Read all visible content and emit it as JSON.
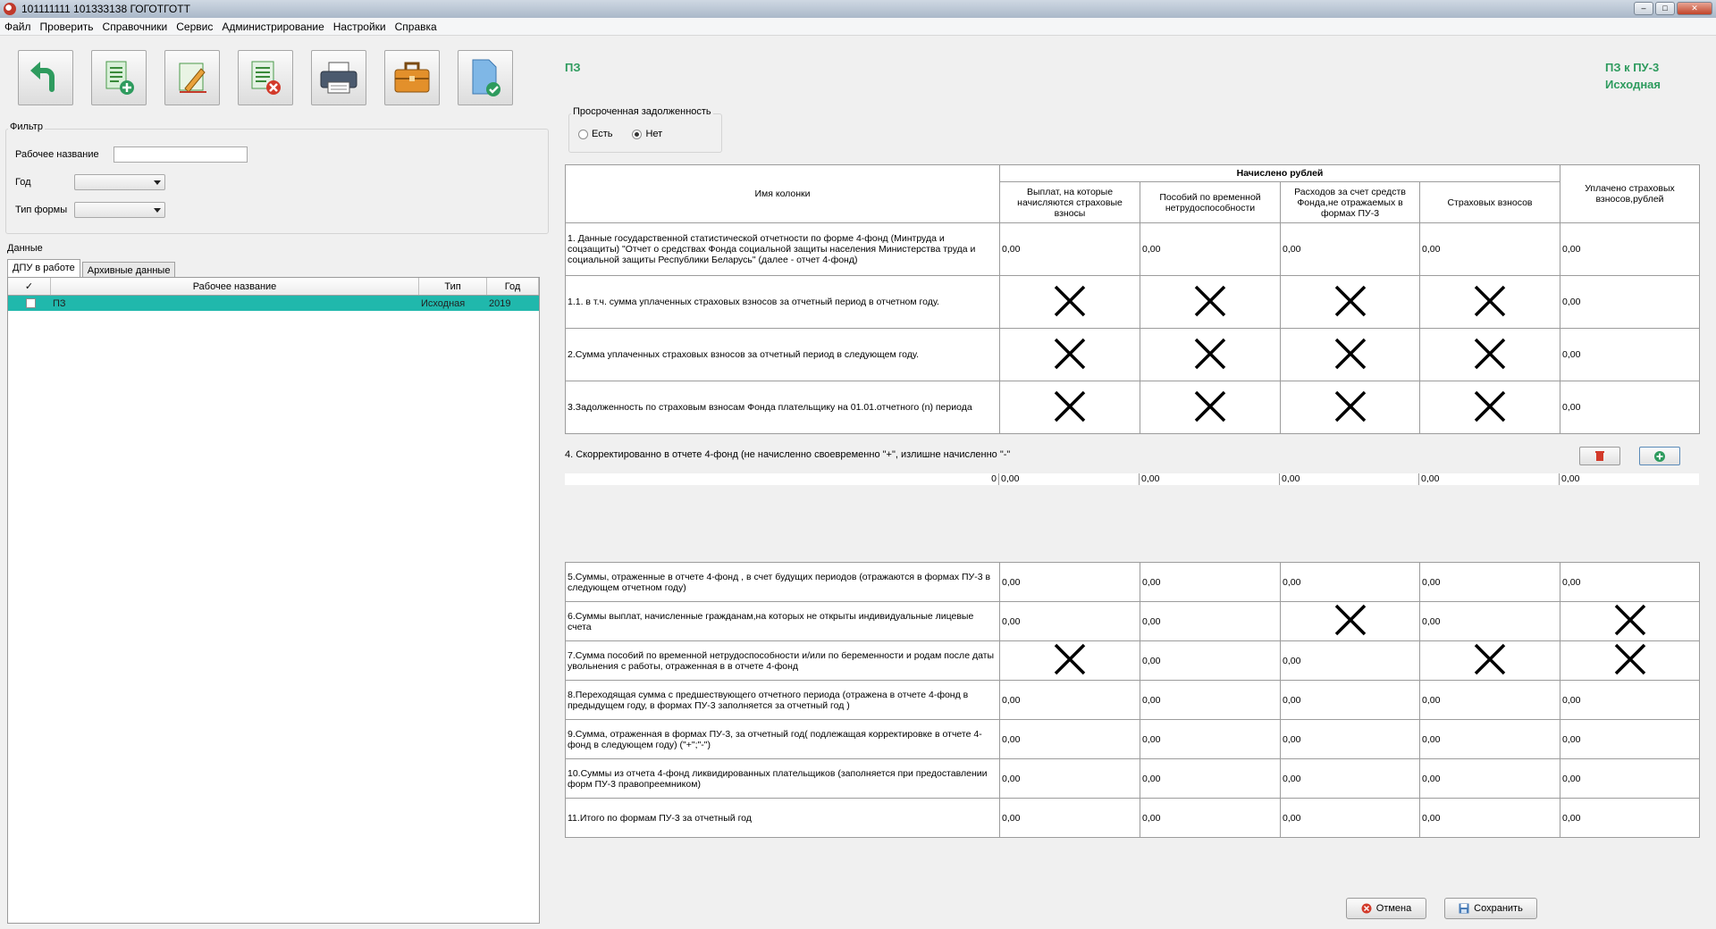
{
  "window": {
    "title": "101111111 101333138 ГОГОТГОТТ"
  },
  "menu": [
    "Файл",
    "Проверить",
    "Справочники",
    "Сервис",
    "Администрирование",
    "Настройки",
    "Справка"
  ],
  "toolbar": {
    "icons": [
      "back-arrow-icon",
      "add-document-icon",
      "edit-document-icon",
      "delete-document-icon",
      "printer-icon",
      "briefcase-icon",
      "check-document-icon"
    ]
  },
  "filter": {
    "title": "Фильтр",
    "name_label": "Рабочее название",
    "name_value": "",
    "year_label": "Год",
    "year_value": "",
    "form_label": "Тип формы",
    "form_value": ""
  },
  "data_section": {
    "title": "Данные",
    "tabs": [
      "ДПУ в работе",
      "Архивные данные"
    ],
    "columns": [
      "✓",
      "Рабочее название",
      "Тип",
      "Год"
    ],
    "rows": [
      {
        "checked": false,
        "name": "ПЗ",
        "type": "Исходная",
        "year": "2019"
      }
    ]
  },
  "form": {
    "short_title": "ПЗ",
    "corner_line1": "ПЗ к ПУ-3",
    "corner_line2": "Исходная",
    "overdue": {
      "title": "Просроченная задолженность",
      "options": [
        "Есть",
        "Нет"
      ],
      "selected": "Нет"
    },
    "table": {
      "col_name_header": "Имя колонки",
      "accrued_header": "Начислено рублей",
      "col_headers": [
        "Выплат, на которые начисляются страховые взносы",
        "Пособий по временной нетрудоспособности",
        "Расходов за счет средств Фонда,не отражаемых в формах ПУ-3",
        "Страховых взносов"
      ],
      "paid_header": "Уплачено страховых взносов,рублей",
      "rows": [
        {
          "label": "1. Данные государственной статистической отчетности по форме 4-фонд (Минтруда и соцзащиты) \"Отчет о средствах Фонда социальной защиты населения Министерства труда и социальной защиты Республики Беларусь\" (далее - отчет 4-фонд)",
          "cells": [
            "0,00",
            "0,00",
            "0,00",
            "0,00",
            "0,00"
          ]
        },
        {
          "label": "1.1. в т.ч. сумма уплаченных страховых взносов за отчетный период в отчетном году.",
          "cells": [
            "X",
            "X",
            "X",
            "X",
            "0,00"
          ]
        },
        {
          "label": "2.Сумма уплаченных страховых взносов за отчетный период в следующем году.",
          "cells": [
            "X",
            "X",
            "X",
            "X",
            "0,00"
          ]
        },
        {
          "label": "3.Задолженность по страховым взносам Фонда плательщику на 01.01.отчетного (n) периода",
          "cells": [
            "X",
            "X",
            "X",
            "X",
            "0,00"
          ]
        }
      ]
    },
    "row4": {
      "label": "4. Скорректированно в отчете 4-фонд (не начисленно своевременно \"+\", излишне начисленно \"-\"",
      "first_value": "0",
      "cells": [
        "0,00",
        "0,00",
        "0,00",
        "0,00",
        "0,00"
      ]
    },
    "lower_rows": [
      {
        "label": "5.Суммы, отраженные в отчете 4-фонд , в счет будущих периодов (отражаются в формах ПУ-3 в следующем отчетном году)",
        "cells": [
          "0,00",
          "0,00",
          "0,00",
          "0,00",
          "0,00"
        ]
      },
      {
        "label": "6.Суммы выплат, начисленные гражданам,на которых не открыты индивидуальные лицевые счета",
        "cells": [
          "0,00",
          "0,00",
          "X",
          "0,00",
          "X"
        ]
      },
      {
        "label": "7.Сумма пособий по временной нетрудоспособности и/или по беременности и родам после даты увольнения с работы, отраженная в в отчете 4-фонд",
        "cells": [
          "X",
          "0,00",
          "0,00",
          "X",
          "X"
        ]
      },
      {
        "label": "8.Переходящая сумма с предшествующего отчетного периода (отражена в отчете 4-фонд в предыдущем году, в формах ПУ-3 заполняется за отчетный год )",
        "cells": [
          "0,00",
          "0,00",
          "0,00",
          "0,00",
          "0,00"
        ]
      },
      {
        "label": "9.Сумма, отраженная в формах ПУ-3, за отчетный год( подлежащая корректировке в отчете 4-фонд в следующем году) (\"+\";\"-\")",
        "cells": [
          "0,00",
          "0,00",
          "0,00",
          "0,00",
          "0,00"
        ]
      },
      {
        "label": "10.Суммы из отчета 4-фонд ликвидированных плательщиков (заполняется при предоставлении форм ПУ-3 правопреемником)",
        "cells": [
          "0,00",
          "0,00",
          "0,00",
          "0,00",
          "0,00"
        ]
      },
      {
        "label": "11.Итого по формам ПУ-3 за отчетный год",
        "cells": [
          "0,00",
          "0,00",
          "0,00",
          "0,00",
          "0,00"
        ]
      }
    ],
    "buttons": {
      "cancel": "Отмена",
      "save": "Сохранить"
    }
  },
  "colors": {
    "accent_green": "#2e9b5e",
    "selected_row": "#20b8ac"
  }
}
